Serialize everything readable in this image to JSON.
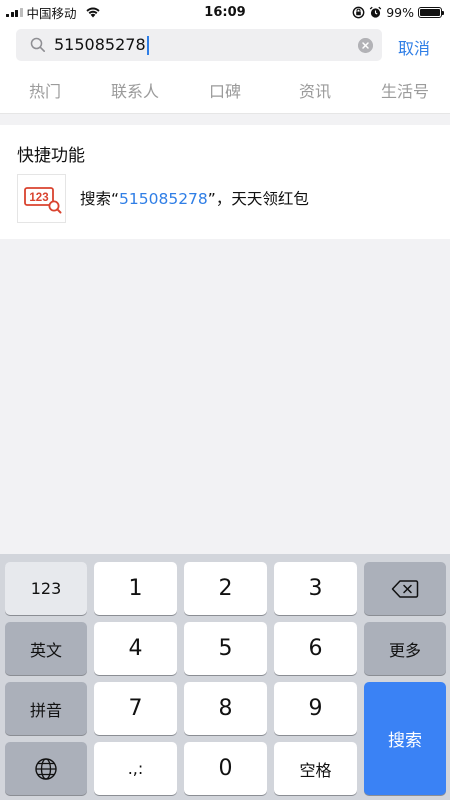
{
  "status_bar": {
    "carrier": "中国移动",
    "time": "16:09",
    "battery_percent_label": "99%",
    "battery_level": 0.99
  },
  "search": {
    "query": "515085278",
    "cancel_label": "取消"
  },
  "tabs": [
    {
      "label": "热门"
    },
    {
      "label": "联系人"
    },
    {
      "label": "口碑"
    },
    {
      "label": "资讯"
    },
    {
      "label": "生活号"
    }
  ],
  "quick_functions": {
    "title": "快捷功能",
    "item": {
      "icon_text": "123",
      "prefix": "搜索“",
      "query": "515085278",
      "suffix": "”，天天领红包"
    }
  },
  "keyboard": {
    "left_keys": [
      "123",
      "英文",
      "拼音"
    ],
    "digits": [
      "1",
      "2",
      "3",
      "4",
      "5",
      "6",
      "7",
      "8",
      "9",
      "0"
    ],
    "punct": ".,:",
    "space": "空格",
    "more": "更多",
    "search": "搜索"
  },
  "colors": {
    "accent": "#2f7ee6",
    "search_key": "#3a82f5",
    "icon_red": "#d9432f"
  }
}
